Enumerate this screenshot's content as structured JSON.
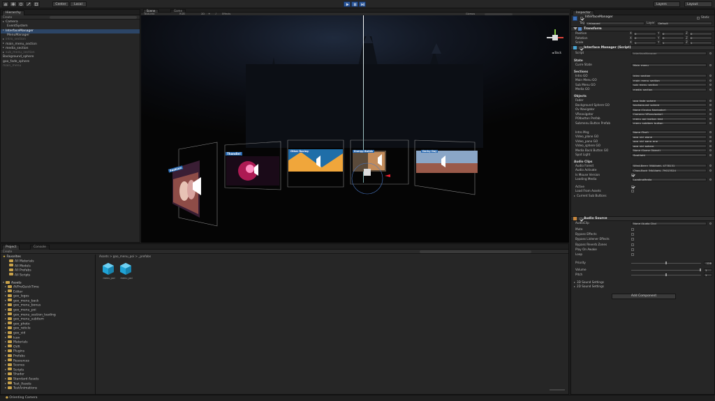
{
  "toolbar": {
    "pivot": "Center",
    "space": "Local",
    "layers": "Layers",
    "layout": "Layout"
  },
  "hierarchy": {
    "tab": "Hierarchy",
    "create": "Create",
    "items": [
      {
        "label": "Camera",
        "indent": 0,
        "expand": true,
        "state": "normal"
      },
      {
        "label": "EventSystem",
        "indent": 1,
        "expand": false,
        "state": "normal"
      },
      {
        "label": "InterfaceManager",
        "indent": 0,
        "expand": true,
        "state": "selected"
      },
      {
        "label": "MenuManager",
        "indent": 1,
        "expand": false,
        "state": "normal"
      },
      {
        "label": "intro_section",
        "indent": 0,
        "expand": true,
        "state": "dim"
      },
      {
        "label": "main_menu_section",
        "indent": 0,
        "expand": true,
        "state": "normal"
      },
      {
        "label": "media_section",
        "indent": 0,
        "expand": true,
        "state": "normal"
      },
      {
        "label": "sub_menu_section",
        "indent": 0,
        "expand": true,
        "state": "dim"
      },
      {
        "label": "Background_sphere",
        "indent": 0,
        "expand": false,
        "state": "normal"
      },
      {
        "label": "goo_fade_sphere",
        "indent": 0,
        "expand": false,
        "state": "normal"
      },
      {
        "label": "main_menu",
        "indent": 0,
        "expand": false,
        "state": "dim"
      }
    ]
  },
  "scene": {
    "tabs": [
      "Scene",
      "Game"
    ],
    "shading": "Textured",
    "render": "RGB",
    "mode_2d": "2D",
    "gizmos": "Gizmos",
    "effects": "Effects",
    "back_label": "Back",
    "cards": [
      {
        "title": "Fashion"
      },
      {
        "title": "Thandie!"
      },
      {
        "title": "Other Racing"
      },
      {
        "title": "Energy Builds"
      },
      {
        "title": "Derby Day"
      }
    ]
  },
  "project": {
    "tabs": [
      "Project",
      "Console"
    ],
    "create": "Create",
    "breadcrumb": "Assets > goo_menu_poi > _prefabs",
    "favorites_label": "Favorites",
    "favorites": [
      "All Materials",
      "All Models",
      "All Prefabs",
      "All Scripts"
    ],
    "assets_label": "Assets",
    "folders": [
      "AVProQuickTime",
      "Editor",
      "goo_logos",
      "goo_menu_back",
      "goo_menu_bonus",
      "goo_menu_poi",
      "goo_menu_section_loading",
      "goo_menu_subitem",
      "goo_photo",
      "goo_reticle",
      "goo_vid",
      "Icon",
      "Materials",
      "OVR",
      "Plugins",
      "Prefabs",
      "Resources",
      "Scenes",
      "Scripts",
      "Shader",
      "Standard Assets",
      "Test_Assets",
      "TestAnimations"
    ],
    "files": [
      "menu_poi",
      "menu_poi"
    ]
  },
  "inspector": {
    "tab": "Inspector",
    "object_name": "InterfaceManager",
    "static_label": "Static",
    "tag_label": "Tag",
    "tag_value": "Untagged",
    "layer_label": "Layer",
    "layer_value": "Default",
    "transform": {
      "title": "Transform",
      "rows": [
        {
          "label": "Position",
          "x": "0",
          "y": "0",
          "z": "0"
        },
        {
          "label": "Rotation",
          "x": "0",
          "y": "0",
          "z": "0"
        },
        {
          "label": "Scale",
          "x": "1",
          "y": "1",
          "z": "1"
        }
      ]
    },
    "script_component": {
      "title": "Interface Manager (Script)",
      "script_label": "Script",
      "script_value": "InterfaceManager",
      "sections": [
        {
          "heading": "State",
          "rows": [
            {
              "label": "Curre State",
              "value": "Main_menu"
            }
          ]
        },
        {
          "heading": "Sections",
          "rows": [
            {
              "label": "Intro GO",
              "value": "intro_section"
            },
            {
              "label": "Main Menu GO",
              "value": "main_menu_section"
            },
            {
              "label": "Sub Menu GO",
              "value": "sub_menu_section"
            },
            {
              "label": "Media GO",
              "value": "media_section"
            }
          ]
        },
        {
          "heading": "Objects",
          "rows": [
            {
              "label": "Fader",
              "value": "goo_fade_sphere"
            },
            {
              "label": "Background Sphere GO",
              "value": "background_sphere"
            },
            {
              "label": "Ov Navigator",
              "value": "None (Oculus Navigator)"
            },
            {
              "label": "VRnavigator",
              "value": "Camera (VRnavigator)"
            },
            {
              "label": "POIbutton Prefab",
              "value": "menu_poi_button_test"
            },
            {
              "label": "Submenu Button Prefab",
              "value": "menu_subitem_button"
            },
            {
              "label": "",
              "value": ""
            },
            {
              "label": "Intro Msg",
              "value": "None (Text)"
            },
            {
              "label": "Video_plane GO",
              "value": "goo_vid_plane"
            },
            {
              "label": "Video_pano GO",
              "value": "goo_vid_pano_ene"
            },
            {
              "label": "Video_sphere GO",
              "value": "goo_vid_sphere"
            },
            {
              "label": "Media Back Button GO",
              "value": "None (Game Object)"
            },
            {
              "label": "Spot Light",
              "value": "Spotlight"
            }
          ]
        },
        {
          "heading": "Audio Clips",
          "rows": [
            {
              "label": "Audio Forest",
              "value": "Wind-Berry_56Ailight- 4778131"
            },
            {
              "label": "Audio Activate",
              "value": "Chop-Bock_56Ailight- 79013524"
            },
            {
              "label": "Is Mouse Version",
              "value": "",
              "check": true
            },
            {
              "label": "Loading Media",
              "value": "LoadingMedia"
            }
          ]
        }
      ],
      "flags": [
        {
          "label": "Active",
          "checked": true
        },
        {
          "label": "Load From Assets",
          "checked": false
        }
      ],
      "current_sub_buttons": "Current Sub Buttons"
    },
    "audio_source": {
      "title": "Audio Source",
      "audio_clip_label": "AudioClip",
      "audio_clip_value": "None (Audio Clip)",
      "toggles": [
        "Mute",
        "Bypass Effects",
        "Bypass Listener Effects",
        "Bypass Reverb Zones",
        "Play On Awake",
        "Loop"
      ],
      "priority_label": "Priority",
      "priority_value": "128",
      "priority_level": 0.5,
      "volume_label": "Volume",
      "volume_value": "1",
      "volume_level": 1.0,
      "pitch_label": "Pitch",
      "pitch_value": "1",
      "pitch_level": 0.5,
      "sound_3d": "3D Sound Settings",
      "sound_2d": "2D Sound Settings"
    },
    "add_component": "Add Component"
  },
  "status": {
    "text": "Orienting Camera"
  },
  "colors": {
    "accent": "#2f5b9e",
    "selection": "#2c4566",
    "folder": "#c9a24a",
    "cube": "#1fa3d6"
  }
}
